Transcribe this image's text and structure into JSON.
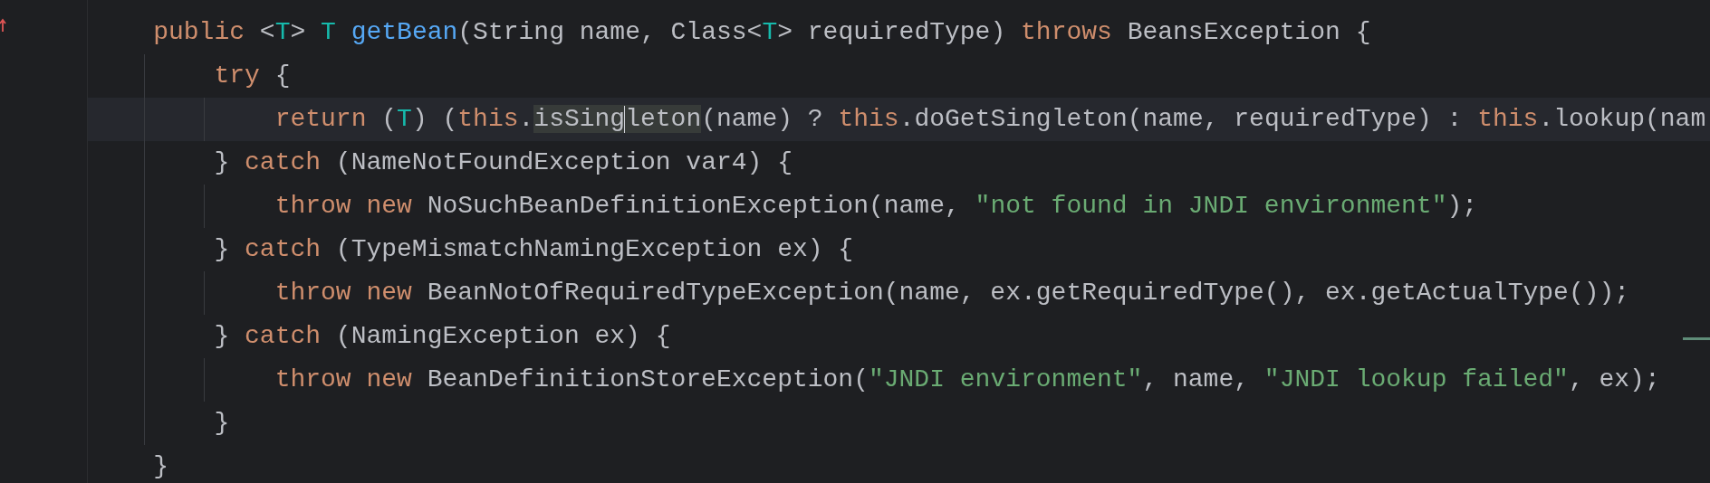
{
  "editor": {
    "lines": [
      {
        "current": false,
        "tokens": [
          {
            "kind": "keyword",
            "text": "    public "
          },
          {
            "kind": "plain",
            "text": "<"
          },
          {
            "kind": "type_param",
            "text": "T"
          },
          {
            "kind": "plain",
            "text": "> "
          },
          {
            "kind": "type_param",
            "text": "T "
          },
          {
            "kind": "method_decl",
            "text": "getBean"
          },
          {
            "kind": "plain",
            "text": "(String name, Class<"
          },
          {
            "kind": "type_param",
            "text": "T"
          },
          {
            "kind": "plain",
            "text": "> requiredType) "
          },
          {
            "kind": "keyword",
            "text": "throws "
          },
          {
            "kind": "plain",
            "text": "BeansException {"
          }
        ]
      },
      {
        "current": false,
        "tokens": [
          {
            "kind": "keyword",
            "text": "        try "
          },
          {
            "kind": "plain",
            "text": "{"
          }
        ]
      },
      {
        "current": true,
        "tokens": [
          {
            "kind": "keyword",
            "text": "            return "
          },
          {
            "kind": "plain",
            "text": "("
          },
          {
            "kind": "type_param",
            "text": "T"
          },
          {
            "kind": "plain",
            "text": ") ("
          },
          {
            "kind": "keyword",
            "text": "this"
          },
          {
            "kind": "plain",
            "text": "."
          },
          {
            "kind": "highlight",
            "text": "isSing"
          },
          {
            "kind": "caret"
          },
          {
            "kind": "highlight",
            "text": "leton"
          },
          {
            "kind": "plain",
            "text": "(name) ? "
          },
          {
            "kind": "keyword",
            "text": "this"
          },
          {
            "kind": "plain",
            "text": ".doGetSingleton(name, requiredType) : "
          },
          {
            "kind": "keyword",
            "text": "this"
          },
          {
            "kind": "plain",
            "text": ".lookup(nam"
          }
        ]
      },
      {
        "current": false,
        "tokens": [
          {
            "kind": "plain",
            "text": "        } "
          },
          {
            "kind": "keyword",
            "text": "catch "
          },
          {
            "kind": "plain",
            "text": "(NameNotFoundException var4) {"
          }
        ]
      },
      {
        "current": false,
        "tokens": [
          {
            "kind": "keyword",
            "text": "            throw new "
          },
          {
            "kind": "plain",
            "text": "NoSuchBeanDefinitionException(name, "
          },
          {
            "kind": "string",
            "text": "\"not found in JNDI environment\""
          },
          {
            "kind": "plain",
            "text": ");"
          }
        ]
      },
      {
        "current": false,
        "tokens": [
          {
            "kind": "plain",
            "text": "        } "
          },
          {
            "kind": "keyword",
            "text": "catch "
          },
          {
            "kind": "plain",
            "text": "(TypeMismatchNamingException ex) {"
          }
        ]
      },
      {
        "current": false,
        "tokens": [
          {
            "kind": "keyword",
            "text": "            throw new "
          },
          {
            "kind": "plain",
            "text": "BeanNotOfRequiredTypeException(name, ex.getRequiredType(), ex.getActualType());"
          }
        ]
      },
      {
        "current": false,
        "tokens": [
          {
            "kind": "plain",
            "text": "        } "
          },
          {
            "kind": "keyword",
            "text": "catch "
          },
          {
            "kind": "plain",
            "text": "(NamingException ex) {"
          }
        ]
      },
      {
        "current": false,
        "tokens": [
          {
            "kind": "keyword",
            "text": "            throw new "
          },
          {
            "kind": "plain",
            "text": "BeanDefinitionStoreException("
          },
          {
            "kind": "string",
            "text": "\"JNDI environment\""
          },
          {
            "kind": "plain",
            "text": ", name, "
          },
          {
            "kind": "string",
            "text": "\"JNDI lookup failed\""
          },
          {
            "kind": "plain",
            "text": ", ex);"
          }
        ]
      },
      {
        "current": false,
        "tokens": [
          {
            "kind": "plain",
            "text": "        }"
          }
        ]
      },
      {
        "current": false,
        "tokens": [
          {
            "kind": "plain",
            "text": "    }"
          }
        ]
      }
    ]
  }
}
